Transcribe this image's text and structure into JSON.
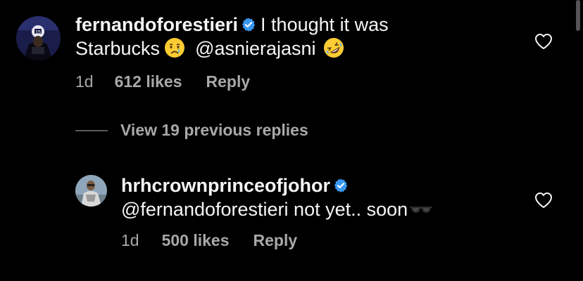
{
  "comments": [
    {
      "username": "fernandoforestieri",
      "verified": true,
      "text_line1": "I thought it was",
      "text_line2_part1": "Starbucks",
      "emoji1": "crying-face",
      "mention": "@asnierajasni",
      "emoji2": "rolling-on-floor-laughing-face",
      "time": "1d",
      "likes": "612 likes",
      "reply_label": "Reply"
    },
    {
      "username": "hrhcrownprinceofjohor",
      "verified": true,
      "mention": "@fernandoforestieri",
      "text": "not yet.. soon",
      "emoji": "sunglasses",
      "time": "1d",
      "likes": "500 likes",
      "reply_label": "Reply"
    }
  ],
  "view_replies": {
    "label": "View 19 previous replies"
  },
  "colors": {
    "background": "#000000",
    "primary_text": "#f5f5f5",
    "secondary_text": "#a8a8a8",
    "verified_badge": "#3897f0"
  }
}
